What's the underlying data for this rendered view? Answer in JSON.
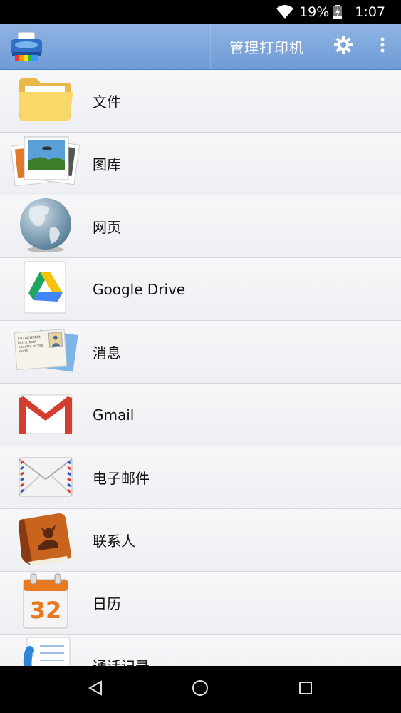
{
  "status_bar": {
    "battery_percent": "19%",
    "time": "1:07",
    "icons": [
      "wifi-icon",
      "battery-charging-icon"
    ]
  },
  "app_bar": {
    "title": "管理打印机",
    "icons": [
      "printer-logo-icon",
      "gear-icon",
      "overflow-menu-icon"
    ]
  },
  "list": {
    "items": [
      {
        "label": "文件",
        "icon": "folder-icon"
      },
      {
        "label": "图库",
        "icon": "gallery-icon"
      },
      {
        "label": "网页",
        "icon": "globe-icon"
      },
      {
        "label": "Google Drive",
        "icon": "google-drive-icon"
      },
      {
        "label": "消息",
        "icon": "messages-icon"
      },
      {
        "label": "Gmail",
        "icon": "gmail-icon"
      },
      {
        "label": "电子邮件",
        "icon": "email-envelope-icon"
      },
      {
        "label": "联系人",
        "icon": "contacts-book-icon"
      },
      {
        "label": "日历",
        "icon": "calendar-icon"
      },
      {
        "label": "通话记录",
        "icon": "call-log-icon"
      }
    ],
    "postcard_text": "KAZAKHSTAN is the best country in the world",
    "calendar_day": "32"
  },
  "nav_bar": {
    "icons": [
      "back-icon",
      "home-icon",
      "recents-icon"
    ]
  }
}
